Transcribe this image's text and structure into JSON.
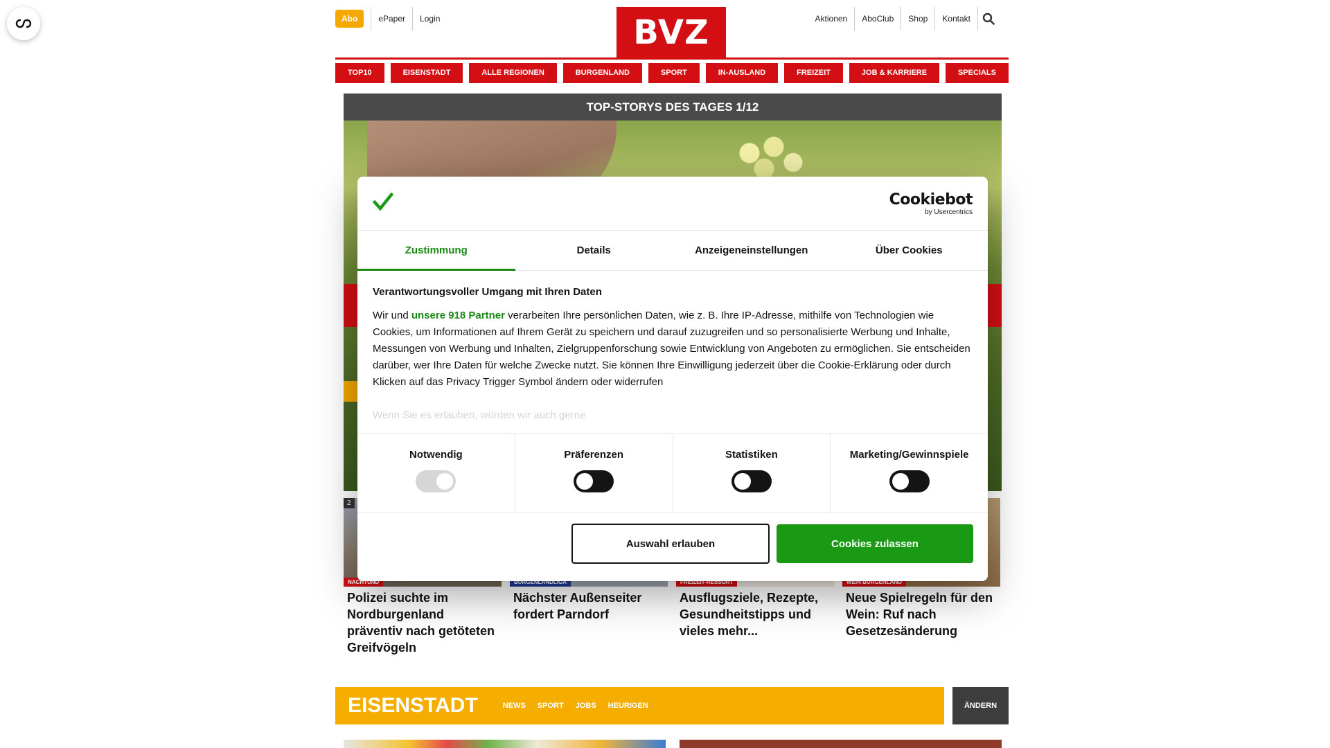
{
  "header": {
    "abo_label": "Abo",
    "left_links": [
      "ePaper",
      "Login"
    ],
    "logo_text": "BVZ",
    "right_links": [
      "Aktionen",
      "AboClub",
      "Shop",
      "Kontakt"
    ]
  },
  "main_nav": [
    "TOP10",
    "EISENSTADT",
    "ALLE REGIONEN",
    "BURGENLAND",
    "SPORT",
    "IN-AUSLAND",
    "FREIZEIT",
    "JOB & KARRIERE",
    "SPECIALS"
  ],
  "top_stories": {
    "title": "TOP-STORYS DES TAGES 1/12"
  },
  "teasers": [
    {
      "number": "2",
      "tag": "NACHTUND",
      "tag_color": "#d40f14",
      "title": "Polizei suchte im Nordburgenland präventiv nach getöteten Greifvögeln"
    },
    {
      "tag": "BURGENLANDLIGA",
      "tag_color": "#1f3a93",
      "title": "Nächster Außenseiter fordert Parndorf"
    },
    {
      "tag": "FREIZEIT-RESSORT",
      "tag_color": "#d40f14",
      "title": "Ausflugsziele, Rezepte, Gesundheitstipps und vieles mehr..."
    },
    {
      "tag": "WEIN BURGENLAND",
      "tag_color": "#d40f14",
      "title": "Neue Spielregeln für den Wein: Ruf nach Gesetzesänderung"
    }
  ],
  "region": {
    "title": "EISENSTADT",
    "links": [
      "NEWS",
      "SPORT",
      "JOBS",
      "HEURIGEN"
    ],
    "change_label": "ÄNDERN"
  },
  "cookie_dialog": {
    "brand": "Cookiebot",
    "brand_sub": "by Usercentrics",
    "tabs": [
      "Zustimmung",
      "Details",
      "Anzeigeneinstellungen",
      "Über Cookies"
    ],
    "heading": "Verantwortungsvoller Umgang mit Ihren Daten",
    "text_before_link": "Wir und ",
    "link_text": "unsere 918 Partner",
    "text_after_link": " verarbeiten Ihre persönlichen Daten, wie z. B. Ihre IP-Adresse, mithilfe von Technologien wie Cookies, um Informationen auf Ihrem Gerät zu speichern und darauf zuzugreifen und so personalisierte Werbung und Inhalte, Messungen von Werbung und Inhalten, Zielgruppenforschung sowie Entwicklung von Angeboten zu ermöglichen. Sie entscheiden darüber, wer Ihre Daten für welche Zwecke nutzt. Sie können Ihre Einwilligung jederzeit über die Cookie-Erklärung oder durch Klicken auf das Privacy Trigger Symbol ändern oder widerrufen",
    "faded_text": "Wenn Sie es erlauben, würden wir auch gerne",
    "toggles": [
      {
        "label": "Notwendig",
        "state": "on-disabled"
      },
      {
        "label": "Präferenzen",
        "state": "off"
      },
      {
        "label": "Statistiken",
        "state": "off"
      },
      {
        "label": "Marketing/Gewinnspiele",
        "state": "off"
      }
    ],
    "allow_selection_label": "Auswahl erlauben",
    "allow_all_label": "Cookies zulassen",
    "accent_color": "#1a9a14"
  }
}
